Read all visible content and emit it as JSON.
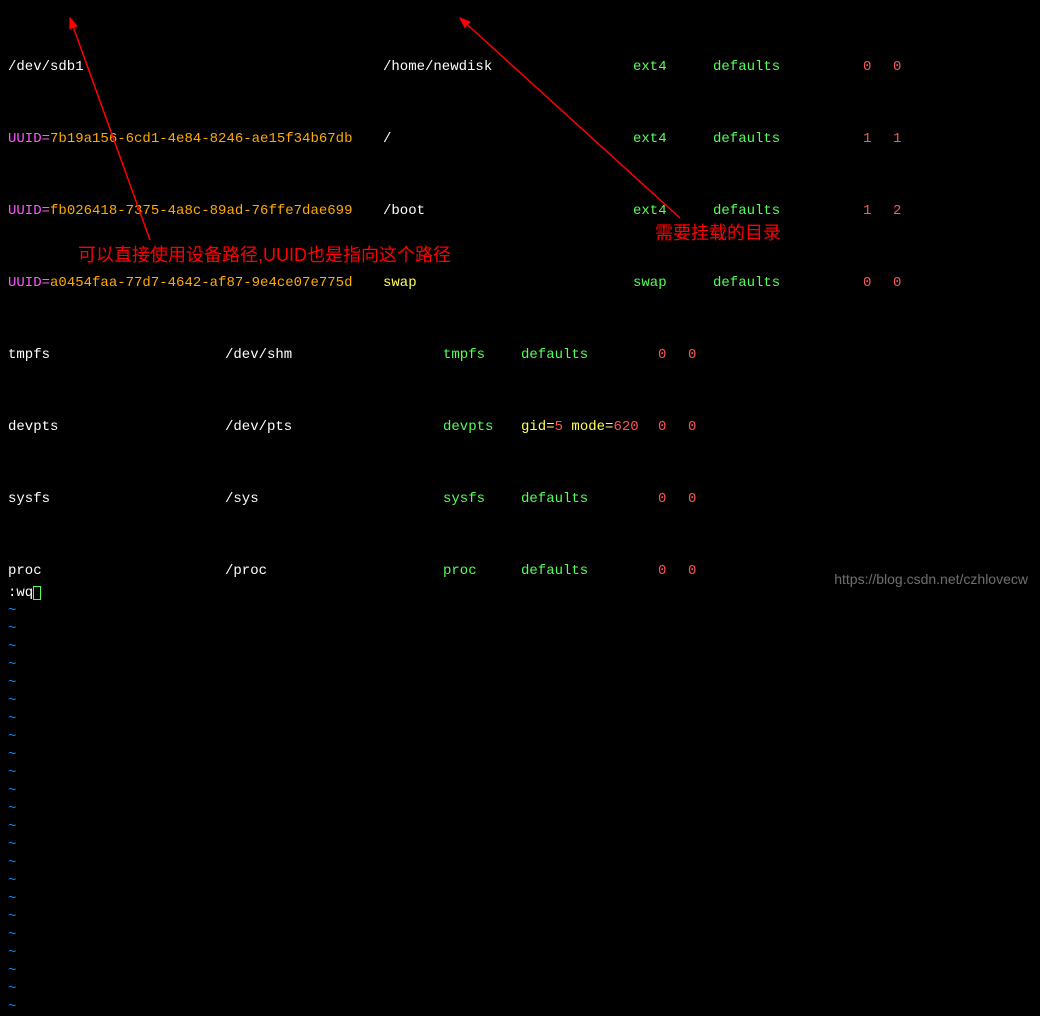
{
  "fstab": {
    "rows": [
      {
        "dev": "/dev/sdb1",
        "mount": "/home/newdisk",
        "type": "ext4",
        "opts": "defaults",
        "dump": "0",
        "pass": "0"
      },
      {
        "uuid_pre": "UUID=",
        "uuid": "7b19a156-6cd1-4e84-8246-ae15f34b67db",
        "mount": "/",
        "type": "ext4",
        "opts": "defaults",
        "dump": "1",
        "pass": "1"
      },
      {
        "uuid_pre": "UUID=",
        "uuid": "fb026418-7375-4a8c-89ad-76ffe7dae699",
        "mount": "/boot",
        "type": "ext4",
        "opts": "defaults",
        "dump": "1",
        "pass": "2"
      },
      {
        "uuid_pre": "UUID=",
        "uuid": "a0454faa-77d7-4642-af87-9e4ce07e775d",
        "mount": "swap",
        "type": "swap",
        "opts": "defaults",
        "dump": "0",
        "pass": "0"
      }
    ],
    "special": [
      {
        "name": "tmpfs",
        "mount": "/dev/shm",
        "type": "tmpfs",
        "opts": "defaults",
        "dump": "0",
        "pass": "0"
      },
      {
        "name": "devpts",
        "mount": "/dev/pts",
        "type": "devpts",
        "opts_pre": "gid=",
        "opts_mid": "5",
        "opts_mode": " mode=",
        "opts_val": "620",
        "dump": "0",
        "pass": "0"
      },
      {
        "name": "sysfs",
        "mount": "/sys",
        "type": "sysfs",
        "opts": "defaults",
        "dump": "0",
        "pass": "0"
      },
      {
        "name": "proc",
        "mount": "/proc",
        "type": "proc",
        "opts": "defaults",
        "dump": "0",
        "pass": "0"
      }
    ]
  },
  "tilde": "~",
  "vim_cmd": ":wq",
  "annotation1": "可以直接使用设备路径,UUID也是指向这个路径",
  "annotation2": "需要挂载的目录",
  "watermark": "https://blog.csdn.net/czhlovecw"
}
